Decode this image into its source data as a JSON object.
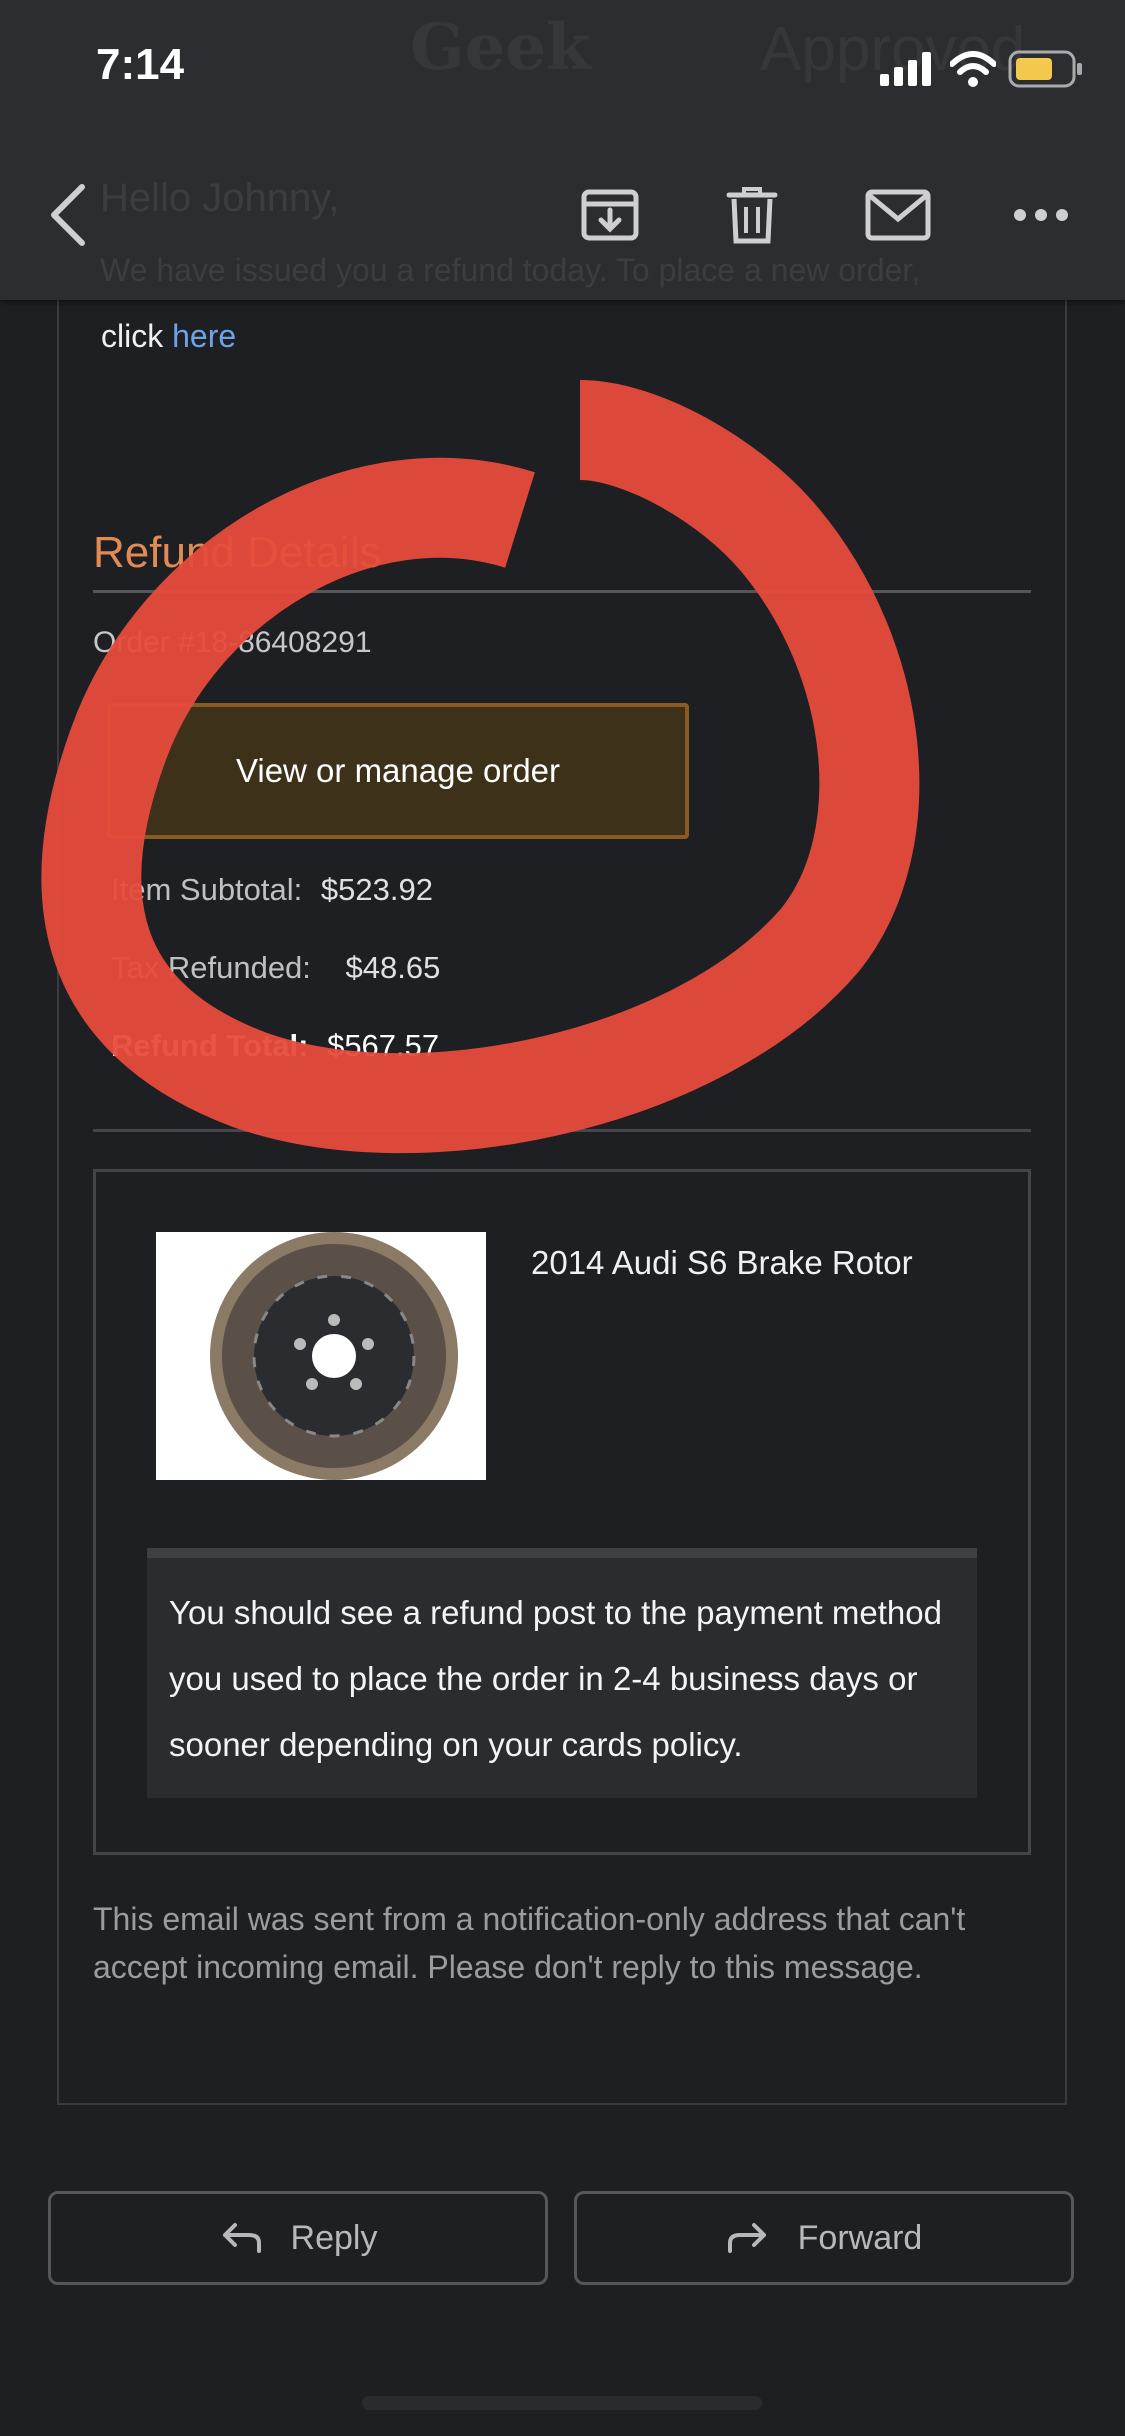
{
  "status_bar": {
    "time": "7:14"
  },
  "background_ghost": {
    "brand": "Geek",
    "approved": "Approved",
    "greeting": "Hello Johnny,",
    "body": "We have issued you a refund today. To place a new order,"
  },
  "nav": {
    "back_icon": "chevron-left-icon",
    "archive_icon": "archive-icon",
    "trash_icon": "trash-icon",
    "mail_icon": "mail-icon",
    "more_icon": "more-icon"
  },
  "email": {
    "click_text": "click",
    "here_link": "here",
    "refund_title": "Refund Details",
    "order_number": "Order #18-86408291",
    "manage_button": "View or manage order",
    "summary": {
      "subtotal_label": "Item Subtotal:",
      "subtotal_value": "$523.92",
      "tax_label": "Tax Refunded:",
      "tax_value": "$48.65",
      "total_label": "Refund Total:",
      "total_value": "$567.57"
    },
    "product_name": "2014 Audi S6 Brake Rotor",
    "info_text": "You should see a refund post to the payment method you used to place the order in 2-4 business days or sooner depending on your cards policy.",
    "footer_note": "This email was sent from a notification-only address that can't accept incoming email. Please don't reply to this message."
  },
  "actions": {
    "reply_label": "Reply",
    "forward_label": "Forward"
  },
  "colors": {
    "accent_orange": "#e08a54",
    "link_blue": "#6ea3e8",
    "scribble_red": "#e74c3c",
    "battery_yellow": "#f2c94c"
  }
}
